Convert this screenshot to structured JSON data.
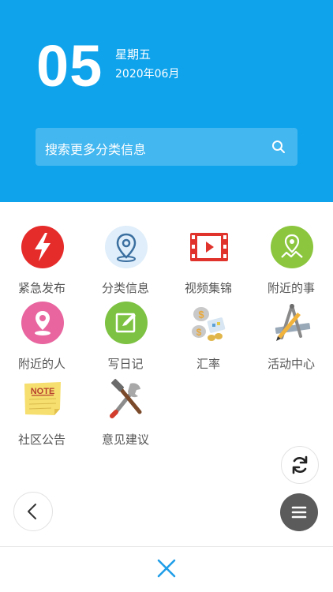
{
  "header": {
    "day": "05",
    "weekday": "星期五",
    "year_month": "2020年06月"
  },
  "search": {
    "placeholder": "搜索更多分类信息"
  },
  "menu": {
    "items": [
      {
        "label": "紧急发布",
        "icon": "lightning-icon"
      },
      {
        "label": "分类信息",
        "icon": "location-pin-icon"
      },
      {
        "label": "视频集锦",
        "icon": "video-film-icon"
      },
      {
        "label": "附近的事",
        "icon": "map-pin-icon"
      },
      {
        "label": "附近的人",
        "icon": "user-pin-icon"
      },
      {
        "label": "写日记",
        "icon": "edit-note-icon"
      },
      {
        "label": "汇率",
        "icon": "money-exchange-icon"
      },
      {
        "label": "活动中心",
        "icon": "drawing-tools-icon"
      },
      {
        "label": "社区公告",
        "icon": "note-icon"
      },
      {
        "label": "意见建议",
        "icon": "tools-icon"
      }
    ]
  },
  "colors": {
    "primary": "#0fa3ec",
    "red": "#e62b2b",
    "green": "#8cc63f",
    "pink": "#e8659f",
    "dark_button": "#5b5b5b"
  }
}
